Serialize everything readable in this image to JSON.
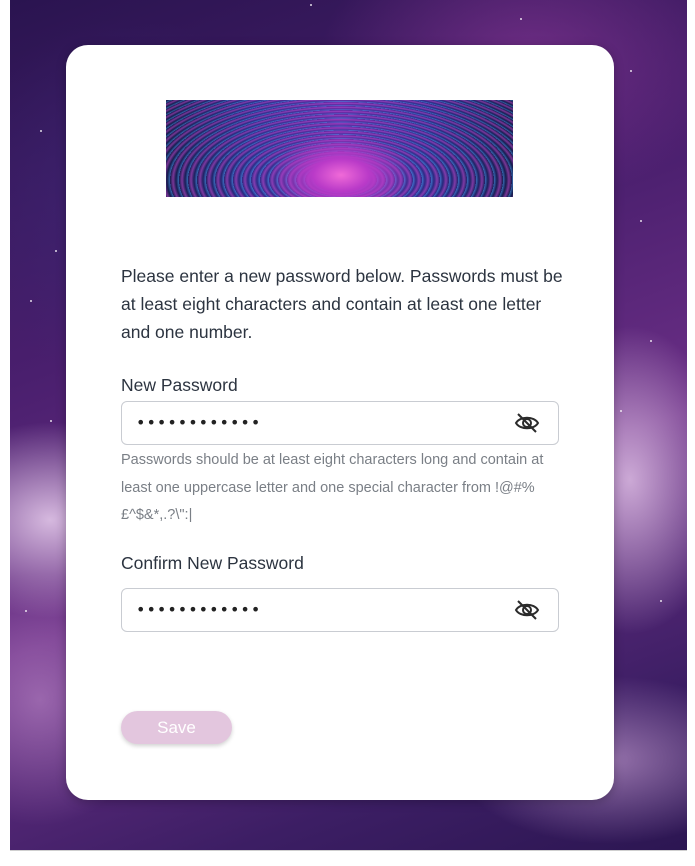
{
  "intro_text": "Please enter a new password below. Passwords must be at least eight characters and contain at least one letter and one number.",
  "new_password": {
    "label": "New Password",
    "value": "••••••••••••",
    "toggle_icon": "eye-off-icon"
  },
  "password_hint": "Passwords should be at least eight characters long and contain at least one uppercase letter and one special character from !@#%£^$&*,.?\\\":|",
  "confirm_password": {
    "label": "Confirm New Password",
    "value": "••••••••••••",
    "toggle_icon": "eye-off-icon"
  },
  "save_label": "Save",
  "colors": {
    "save_button": "#e3c6de",
    "text": "#2c3440",
    "hint": "#7a7f86"
  }
}
